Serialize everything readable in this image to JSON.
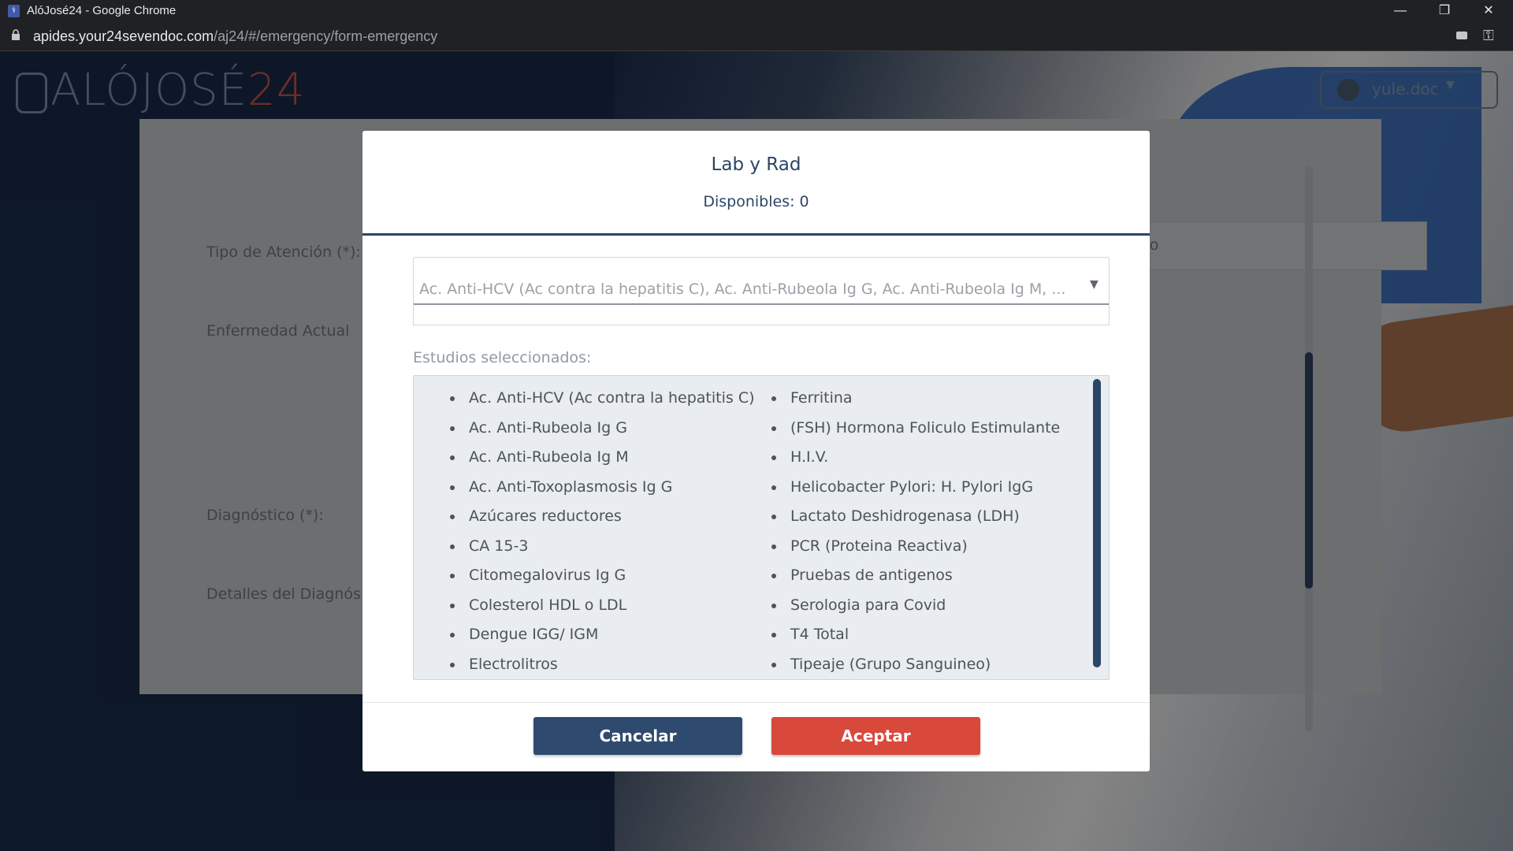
{
  "browser": {
    "window_title": "AlóJosé24 - Google Chrome",
    "url_host": "apides.your24sevendoc.com",
    "url_path": "/aj24/#/emergency/form-emergency",
    "controls": {
      "minimize": "—",
      "restore": "❐",
      "close": "✕"
    }
  },
  "app": {
    "logo_main": "ALÓJOSÉ",
    "logo_num": "24",
    "user_name": "yule.doc",
    "user_caret": "▼"
  },
  "form": {
    "tipo_label": "Tipo de Atención (*):",
    "tipo_value_fragment": "ario",
    "enfermedad_label": "Enfermedad Actual",
    "diagnostico_label": "Diagnóstico (*):",
    "detalles_label": "Detalles del Diagnós"
  },
  "modal": {
    "title": "Lab y Rad",
    "subtitle": "Disponibles: 0",
    "select_value": "Ac. Anti-HCV (Ac contra la hepatitis C), Ac. Anti-Rubeola Ig G, Ac. Anti-Rubeola Ig M, ...",
    "select_arrow": "▼",
    "studies_label": "Estudios seleccionados:",
    "studies_col1": [
      "Ac. Anti-HCV (Ac contra la hepatitis C)",
      "Ac. Anti-Rubeola Ig G",
      "Ac. Anti-Rubeola Ig M",
      "Ac. Anti-Toxoplasmosis Ig G",
      "Azúcares reductores",
      "CA 15-3",
      "Citomegalovirus Ig G",
      "Colesterol HDL o LDL",
      "Dengue IGG/ IGM",
      "Electrolitros"
    ],
    "studies_col2": [
      "Ferritina",
      "(FSH) Hormona Foliculo Estimulante",
      "H.I.V.",
      "Helicobacter Pylori: H. Pylori IgG",
      "Lactato Deshidrogenasa (LDH)",
      "PCR (Proteina Reactiva)",
      "Pruebas de antigenos",
      "Serologia para Covid",
      "T4 Total",
      "Tipeaje (Grupo Sanguineo)"
    ],
    "cancel_label": "Cancelar",
    "accept_label": "Aceptar"
  },
  "colors": {
    "primary": "#2e4a6e",
    "danger": "#d8483b",
    "header_text": "#2b4566"
  }
}
